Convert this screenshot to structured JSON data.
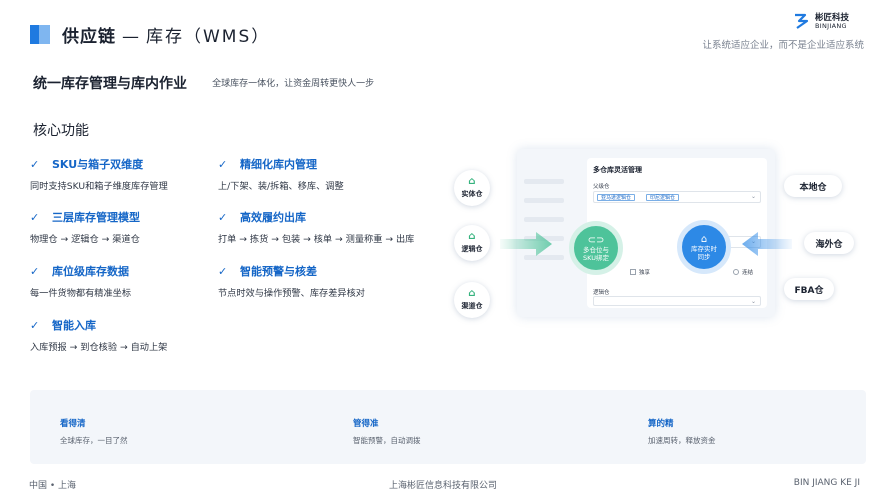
{
  "header": {
    "title": "供应链",
    "separator": "—",
    "subtitle": "库存（WMS）",
    "logo_cn": "彬匠科技",
    "logo_en": "BINJIANG",
    "slogan": "让系统适应企业，而不是企业适应系统",
    "accent": "#1f7ae0"
  },
  "headline": {
    "title": "统一库存管理与库内作业",
    "subtitle": "全球库存一体化，让资金周转更快人一步"
  },
  "core": {
    "label": "核心功能",
    "check_icon": "check-icon",
    "features": [
      {
        "title": "SKU与箱子双维度",
        "desc": "同时支持SKU和箱子维度库存管理"
      },
      {
        "title": "精细化库内管理",
        "desc": "上/下架、装/拆箱、移库、调整"
      },
      {
        "title": "三层库存管理模型",
        "desc": "物理仓 → 逻辑仓 → 渠道仓"
      },
      {
        "title": "高效履约出库",
        "desc": "打单 → 拣货 → 包装 → 核单 → 测量称重 → 出库"
      },
      {
        "title": "库位级库存数据",
        "desc": "每一件货物都有精准坐标"
      },
      {
        "title": "智能预警与核差",
        "desc": "节点时效与操作预警、库存差异核对"
      },
      {
        "title": "智能入库",
        "desc": "入库预报 → 到仓核验 → 自动上架"
      }
    ]
  },
  "diagram": {
    "panel_title": "多仓库灵活管理",
    "parent_label": "父级仓",
    "tag1": "亚马逊逻辑仓",
    "tag2": "印尼逻辑仓",
    "exclusive_label": "独享",
    "link_label": "连结",
    "logic_label": "逻辑仓",
    "green_node": [
      "多仓位与",
      "SKU绑定"
    ],
    "blue_node": [
      "库存实时",
      "同步"
    ],
    "left_nodes": [
      "实体仓",
      "逻辑仓",
      "渠道仓"
    ],
    "right_nodes": [
      "本地仓",
      "海外仓",
      "FBA仓"
    ],
    "green": "#4ec39a",
    "blue": "#2d89e6"
  },
  "benefits": [
    {
      "title": "看得清",
      "desc": "全球库存，一目了然"
    },
    {
      "title": "管得准",
      "desc": "智能预警，自动调拨"
    },
    {
      "title": "算的精",
      "desc": "加速周转，释放资金"
    }
  ],
  "footer": {
    "left": "中国 • 上海",
    "center": "上海彬匠信息科技有限公司",
    "right": "BIN JIANG KE JI"
  }
}
